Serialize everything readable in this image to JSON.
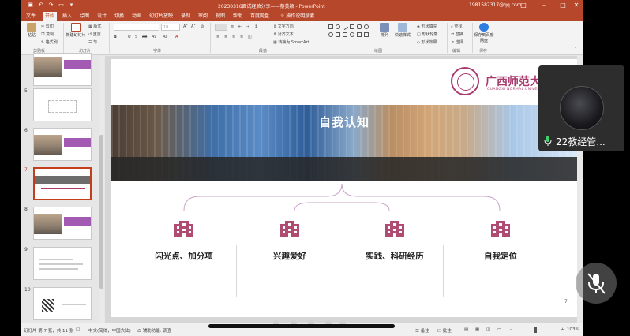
{
  "app": {
    "window_title": "20230316面试经验分享——蔡美颖 - PowerPoint",
    "account": "1981587317@qq.com"
  },
  "tabs": [
    "文件",
    "开始",
    "插入",
    "绘图",
    "设计",
    "切换",
    "动画",
    "幻灯片放映",
    "录制",
    "审阅",
    "视图",
    "帮助",
    "百度网盘",
    "操作说明搜索"
  ],
  "active_tab": "开始",
  "ribbon": {
    "clipboard": {
      "paste": "粘贴",
      "cut": "剪切",
      "copy": "复制",
      "format_painter": "格式刷",
      "label": "剪贴板"
    },
    "slides": {
      "new_slide": "新建幻灯片",
      "layout": "版式",
      "reset": "重置",
      "section": "节",
      "label": "幻灯片"
    },
    "font": {
      "label": "字体",
      "size": "18"
    },
    "paragraph": {
      "text_direction": "文字方向",
      "align_text": "对齐文本",
      "smartart": "转换为 SmartArt",
      "label": "段落"
    },
    "drawing": {
      "arrange": "排列",
      "quick_styles": "快速样式",
      "shape_fill": "形状填充",
      "shape_outline": "形状轮廓",
      "shape_effects": "形状效果",
      "label": "绘图"
    },
    "editing": {
      "find": "查找",
      "replace": "替换",
      "select": "选择",
      "label": "编辑"
    },
    "save": {
      "save_to_baidu": "保存到百度网盘",
      "label": "保存"
    }
  },
  "thumbnails": [
    {
      "num": "5"
    },
    {
      "num": "6"
    },
    {
      "num": "7"
    },
    {
      "num": "8"
    },
    {
      "num": "9"
    },
    {
      "num": "10"
    }
  ],
  "current_slide": "7",
  "slide": {
    "title": "自我认知",
    "logo_cn": "广西师范大学",
    "logo_en": "GUANGXI NORMAL UNIVERSITY",
    "items": [
      "闪光点、加分项",
      "兴趣爱好",
      "实践、科研经历",
      "自我定位"
    ],
    "page_number": "7",
    "accent_color": "#a83a6e"
  },
  "statusbar": {
    "slide_info": "幻灯片 第 7 张，共 11 张",
    "language": "中文(简体，中国大陆)",
    "accessibility": "辅助功能: 调查",
    "notes": "备注",
    "comments": "批注",
    "zoom": "103%"
  },
  "meeting": {
    "participant_name": "22教经管..."
  },
  "colors": {
    "ppt_red": "#b7472a",
    "selected_thumb": "#c43e1c"
  }
}
